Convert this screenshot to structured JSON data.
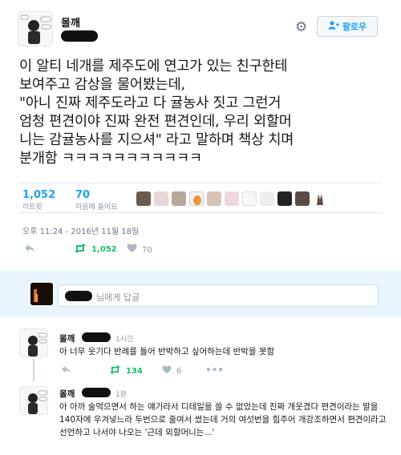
{
  "tweet": {
    "author_name": "몰깨",
    "follow_label": "팔로우",
    "text": "이 알티 네개를 제주도에 연고가 있는 친구한테\n보여주고 감상을 물어봤는데,\n\"아니 진짜 제주도라고 다 귤농사 짓고 그런거\n엄청 편견이야 진짜 완전 편견인데, 우리 외할머\n니는 감귤농사를 지으셔\" 라고 말하며 책상 치며\n분개함 ㅋㅋㅋㅋㅋㅋㅋㅋㅋㅋㅋ",
    "retweets": {
      "count": "1,052",
      "label": "리트윗"
    },
    "likes": {
      "count": "70",
      "label": "마음에 들어요"
    },
    "timestamp": "오후 11:24 - 2016년 11월 18일",
    "actions": {
      "reply_icon": "reply-icon",
      "retweet_count": "1,052",
      "like_count": "70"
    }
  },
  "reply_box": {
    "placeholder_suffix": "님에게 답글"
  },
  "replies": [
    {
      "name": "몰깨",
      "time": "1시간",
      "text": "아 너무 웃기다 반례를 들어 반박하고 싶어하는데 반박을 못함",
      "retweet_count": "134",
      "like_count": "6"
    },
    {
      "name": "몰깨",
      "time": "1분",
      "text": "아 아까 술먹으면서 하는 얘기라서 디테일을 쓸 수 없었는데 진짜 개웃겼다 편견이라는 말을 140자에 우겨넣느라 두번으로 줄여서 썼는데 거의 여섯번을 힘주어 개강조하면서 편견이라고 선언하고 나서야 나오는 '근데 외할머니는...'"
    }
  ],
  "colors": {
    "accent": "#1da1f2",
    "retweet_green": "#17bf63",
    "reply_area_bg": "#e8f5fd"
  }
}
